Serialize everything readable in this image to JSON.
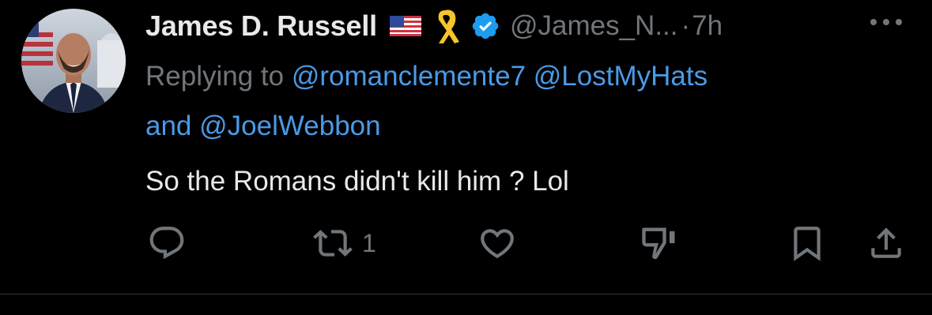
{
  "tweet": {
    "author": {
      "display_name": "James D. Russell",
      "handle": "@James_N...",
      "verified": true,
      "badges": [
        "us-flag-icon",
        "yellow-ribbon-icon",
        "verified-badge-icon"
      ]
    },
    "separator": "·",
    "time": "7h",
    "reply": {
      "prefix": "Replying to ",
      "mentions": [
        "@romanclemente7",
        "@LostMyHats"
      ],
      "conjunction": "and",
      "last_mention": "@JoelWebbon"
    },
    "text": "So the Romans didn't kill him ? Lol",
    "actions": {
      "reply": {
        "icon": "reply-icon"
      },
      "retweet": {
        "icon": "retweet-icon",
        "count": "1"
      },
      "like": {
        "icon": "heart-icon"
      },
      "downvote": {
        "icon": "downvote-icon"
      },
      "bookmark": {
        "icon": "bookmark-icon"
      },
      "share": {
        "icon": "share-icon"
      }
    },
    "more": {
      "icon": "more-icon"
    }
  },
  "colors": {
    "background": "#000000",
    "text": "#e7e9ea",
    "muted": "#71767b",
    "link": "#4a9ae6",
    "verified": "#1d9bf0",
    "ribbon": "#f5c52a"
  }
}
